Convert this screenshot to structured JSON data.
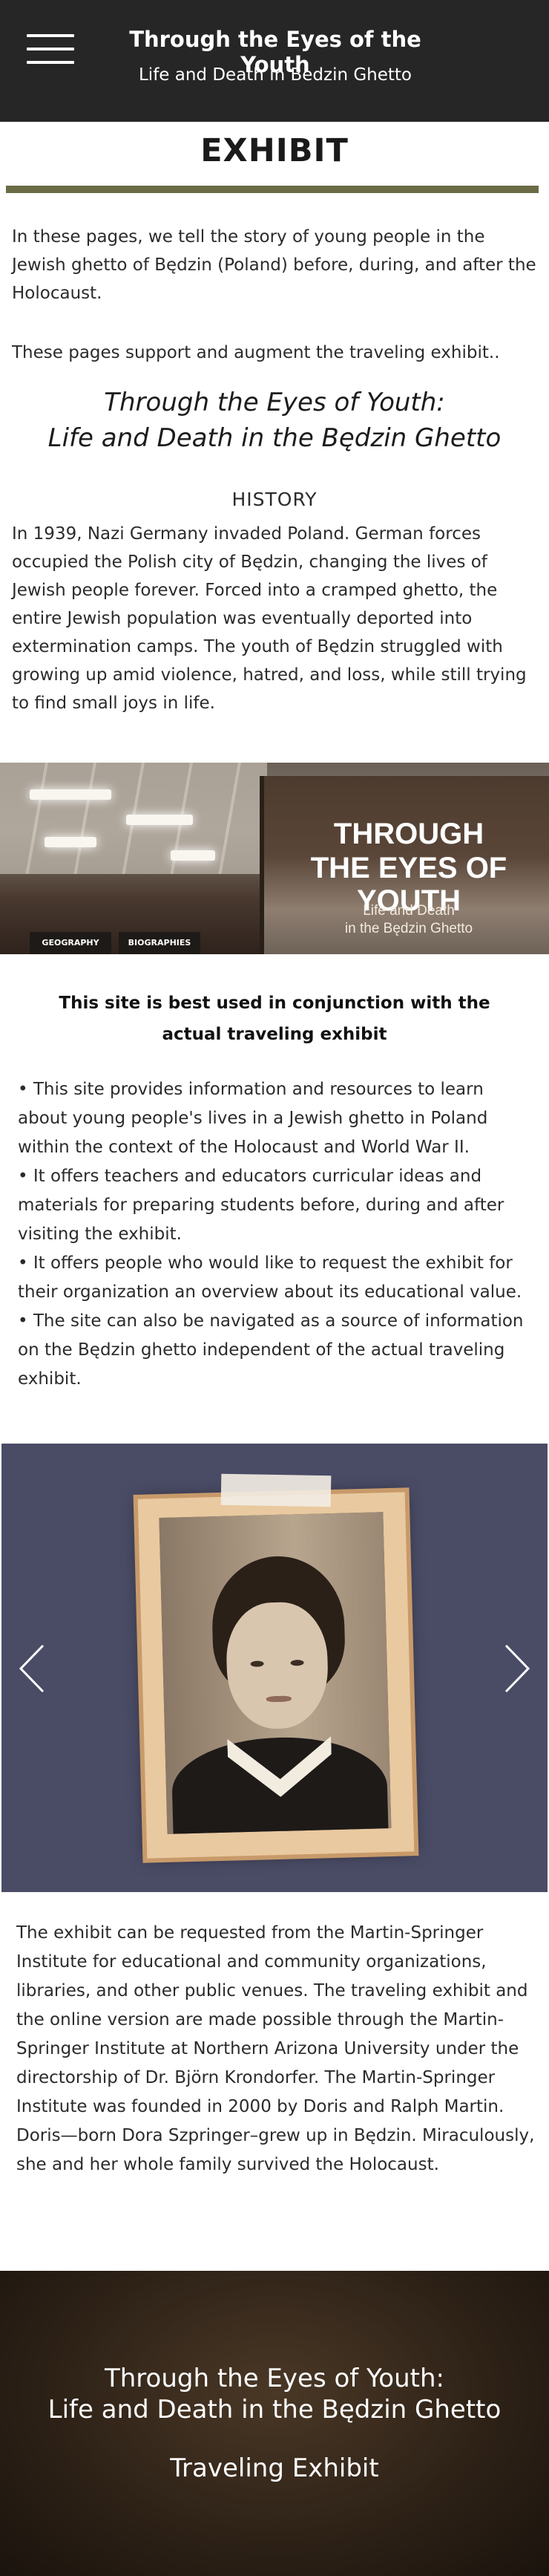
{
  "header": {
    "menu_icon": "hamburger-menu-icon",
    "site_title": "Through the Eyes of the Youth",
    "site_subtitle": "Life and Death in Bedzin Ghetto"
  },
  "page": {
    "title": "EXHIBIT",
    "intro_1": "In these pages, we tell the story of young people in the Jewish ghetto of Będzin (Poland) before, during, and after the Holocaust.",
    "intro_2": "These pages support and augment the traveling exhibit..",
    "exhibit_title_line1": "Through the Eyes of Youth:",
    "exhibit_title_line2": "Life and Death in the Będzin Ghetto",
    "history_heading": "HISTORY",
    "history_text": "In 1939, Nazi Germany invaded Poland. German forces occupied the Polish city of Będzin, changing the lives of Jewish people forever. Forced into a cramped ghetto, the entire Jewish population was eventually deported into extermination camps. The youth of Będzin struggled with growing up amid violence, hatred, and loss, while still trying to find small joys in life."
  },
  "exhibit_photo": {
    "panel_label_1": "GEOGRAPHY",
    "panel_label_2": "BIOGRAPHIES",
    "sign_line1": "THROUGH",
    "sign_line2": "THE EYES OF YOUTH",
    "sign_sub1": "Life and Death",
    "sign_sub2": "in the Będzin Ghetto"
  },
  "usage": {
    "best_used": "This site is best used in conjunction with the actual traveling exhibit",
    "bullets": [
      "• This site provides information and resources to learn about young people's lives in a Jewish ghetto in Poland within the context of the Holocaust and World War II.",
      "• It offers teachers and educators curricular ideas and materials for preparing students before, during and after visiting the exhibit.",
      "• It offers people who would like to request the exhibit for their organization an overview about its educational value.",
      "• The site can also be navigated as a source of information on the Będzin ghetto independent of the actual traveling exhibit."
    ]
  },
  "carousel": {
    "prev_icon": "chevron-left-icon",
    "next_icon": "chevron-right-icon",
    "background_color": "#4a4c66"
  },
  "info": {
    "text": "The exhibit can be requested from the Martin-Springer Institute for educational and community organizations, libraries, and other public venues. The traveling exhibit and the online version are made possible through the Martin-Springer Institute at Northern Arizona University under the directorship of Dr. Björn Krondorfer. The Martin-Springer Institute was founded in 2000 by Doris and Ralph Martin. Doris—born Dora Szpringer–grew up in Będzin. Miraculously, she and her whole family survived the Holocaust."
  },
  "footer": {
    "title_line1": "Through the Eyes of Youth:",
    "title_line2": "Life and Death in the Będzin Ghetto",
    "subtitle": "Traveling Exhibit"
  },
  "colors": {
    "header_bg": "#262626",
    "accent_rule": "#6b6b46",
    "footer_bg": "#2e2217"
  }
}
